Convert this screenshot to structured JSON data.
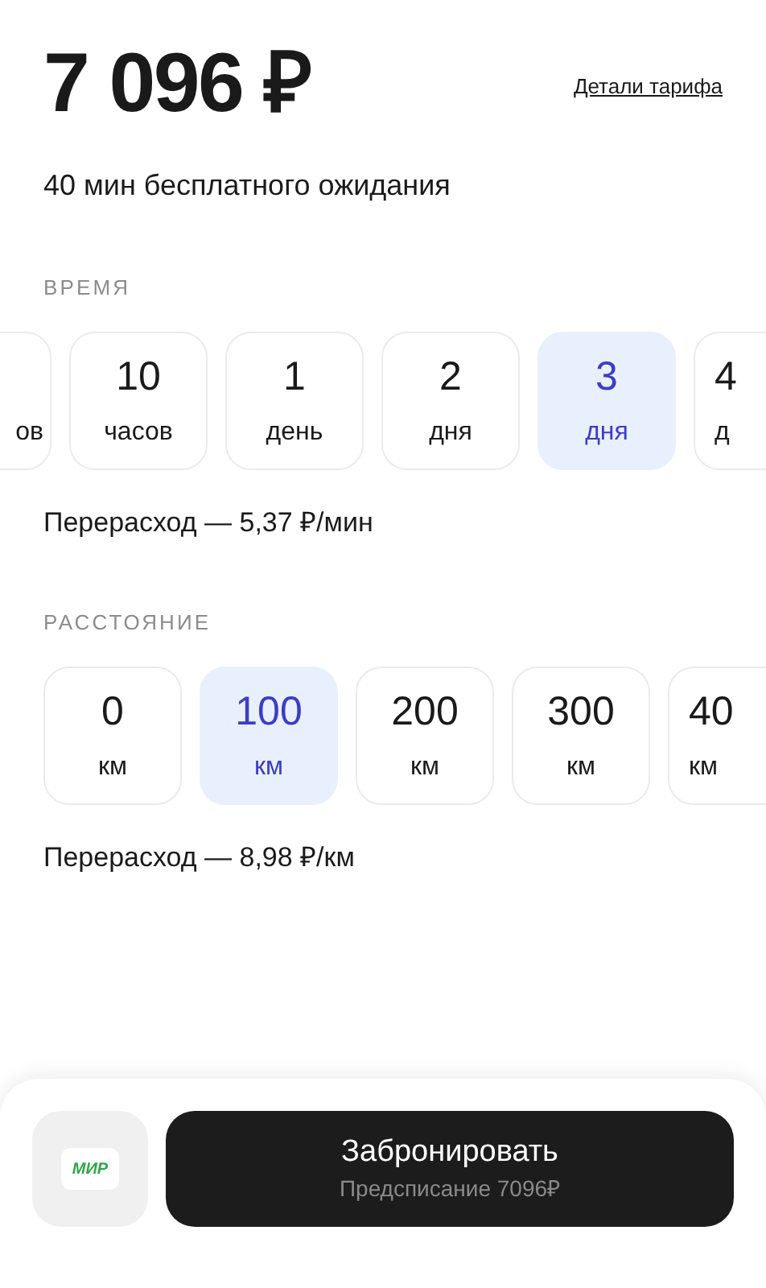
{
  "price": "7 096 ₽",
  "tariff_link": "Детали тарифа",
  "free_wait": "40 мин бесплатного ожидания",
  "time": {
    "title": "ВРЕМЯ",
    "options": [
      {
        "kind": "clipped-left",
        "unit": "ов",
        "selected": false
      },
      {
        "kind": "full",
        "value": "10",
        "unit": "часов",
        "selected": false
      },
      {
        "kind": "full",
        "value": "1",
        "unit": "день",
        "selected": false
      },
      {
        "kind": "full",
        "value": "2",
        "unit": "дня",
        "selected": false
      },
      {
        "kind": "full",
        "value": "3",
        "unit": "дня",
        "selected": true
      },
      {
        "kind": "clipped-right",
        "value": "4",
        "unit": "д",
        "selected": false
      }
    ],
    "overage": "Перерасход — 5,37 ₽/мин"
  },
  "distance": {
    "title": "РАССТОЯНИЕ",
    "options": [
      {
        "kind": "full",
        "value": "0",
        "unit": "км",
        "selected": false
      },
      {
        "kind": "full",
        "value": "100",
        "unit": "км",
        "selected": true
      },
      {
        "kind": "full",
        "value": "200",
        "unit": "км",
        "selected": false
      },
      {
        "kind": "full",
        "value": "300",
        "unit": "км",
        "selected": false
      },
      {
        "kind": "clipped-right",
        "value": "40",
        "unit": "км",
        "selected": false
      }
    ],
    "overage": "Перерасход — 8,98 ₽/км"
  },
  "payment_card": "МИР",
  "book_button": {
    "label": "Забронировать",
    "sublabel": "Предсписание 7096₽"
  }
}
